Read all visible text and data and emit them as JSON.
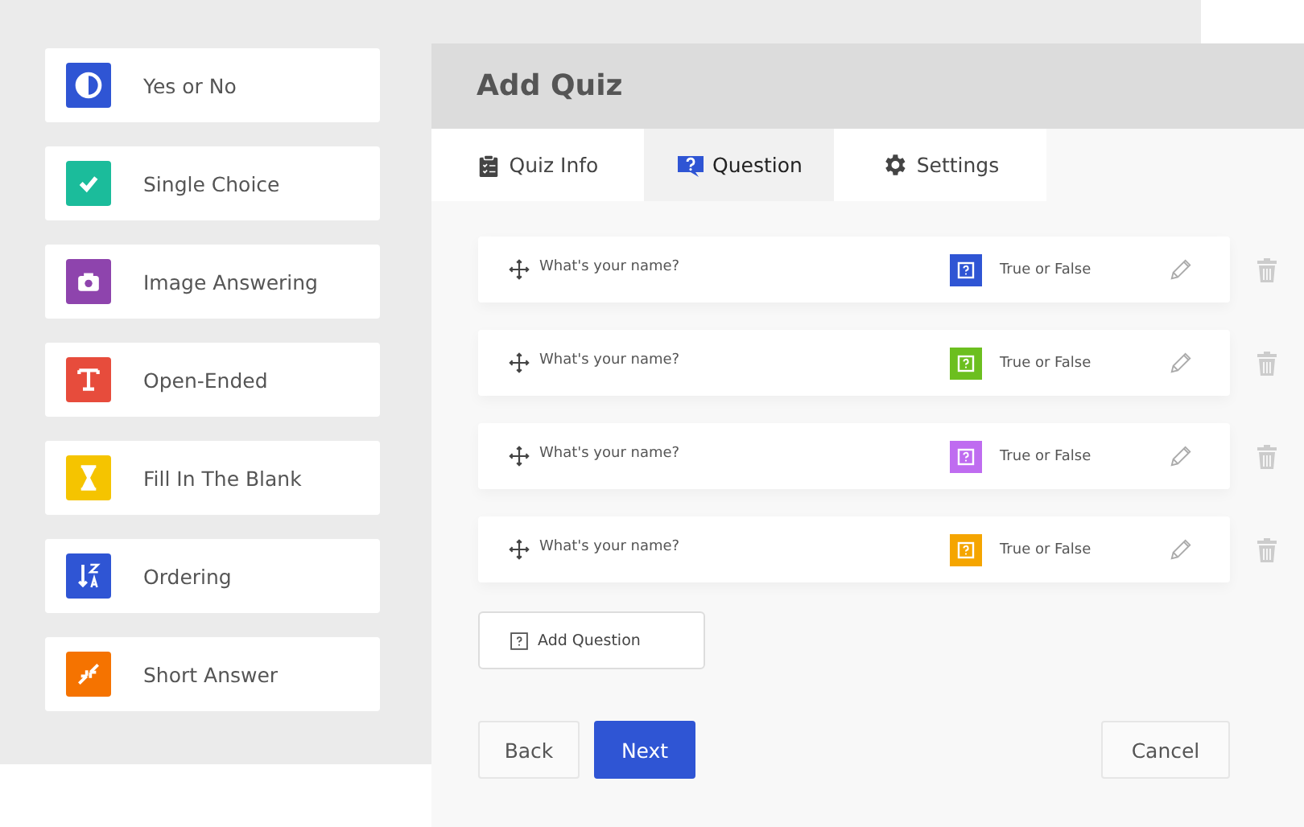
{
  "question_types": [
    {
      "label": "Yes or No",
      "kind": "half",
      "color": "#2f55d4"
    },
    {
      "label": "Single Choice",
      "kind": "check",
      "color": "#1bbc9b"
    },
    {
      "label": "Image Answering",
      "kind": "camera",
      "color": "#8e44ad"
    },
    {
      "label": "Open-Ended",
      "kind": "text",
      "color": "#e74c3c"
    },
    {
      "label": "Fill In The Blank",
      "kind": "hourglass",
      "color": "#f5c400"
    },
    {
      "label": "Ordering",
      "kind": "sort",
      "color": "#2f55d4"
    },
    {
      "label": "Short Answer",
      "kind": "shrink",
      "color": "#f57300"
    }
  ],
  "panel": {
    "title": "Add Quiz"
  },
  "tabs": [
    {
      "label": "Quiz Info",
      "kind": "clipboard",
      "selected": false
    },
    {
      "label": "Question",
      "kind": "question",
      "selected": true
    },
    {
      "label": "Settings",
      "kind": "gear",
      "selected": false
    }
  ],
  "questions": [
    {
      "text": "What's your name?",
      "type": "True or False",
      "color": "#2f55d4"
    },
    {
      "text": "What's your name?",
      "type": "True or False",
      "color": "#6cbf1f"
    },
    {
      "text": "What's your name?",
      "type": "True or False",
      "color": "#bf6cf0"
    },
    {
      "text": "What's your name?",
      "type": "True or False",
      "color": "#f5a500"
    }
  ],
  "add_button": "Add Question",
  "buttons": {
    "back": "Back",
    "next": "Next",
    "cancel": "Cancel"
  }
}
